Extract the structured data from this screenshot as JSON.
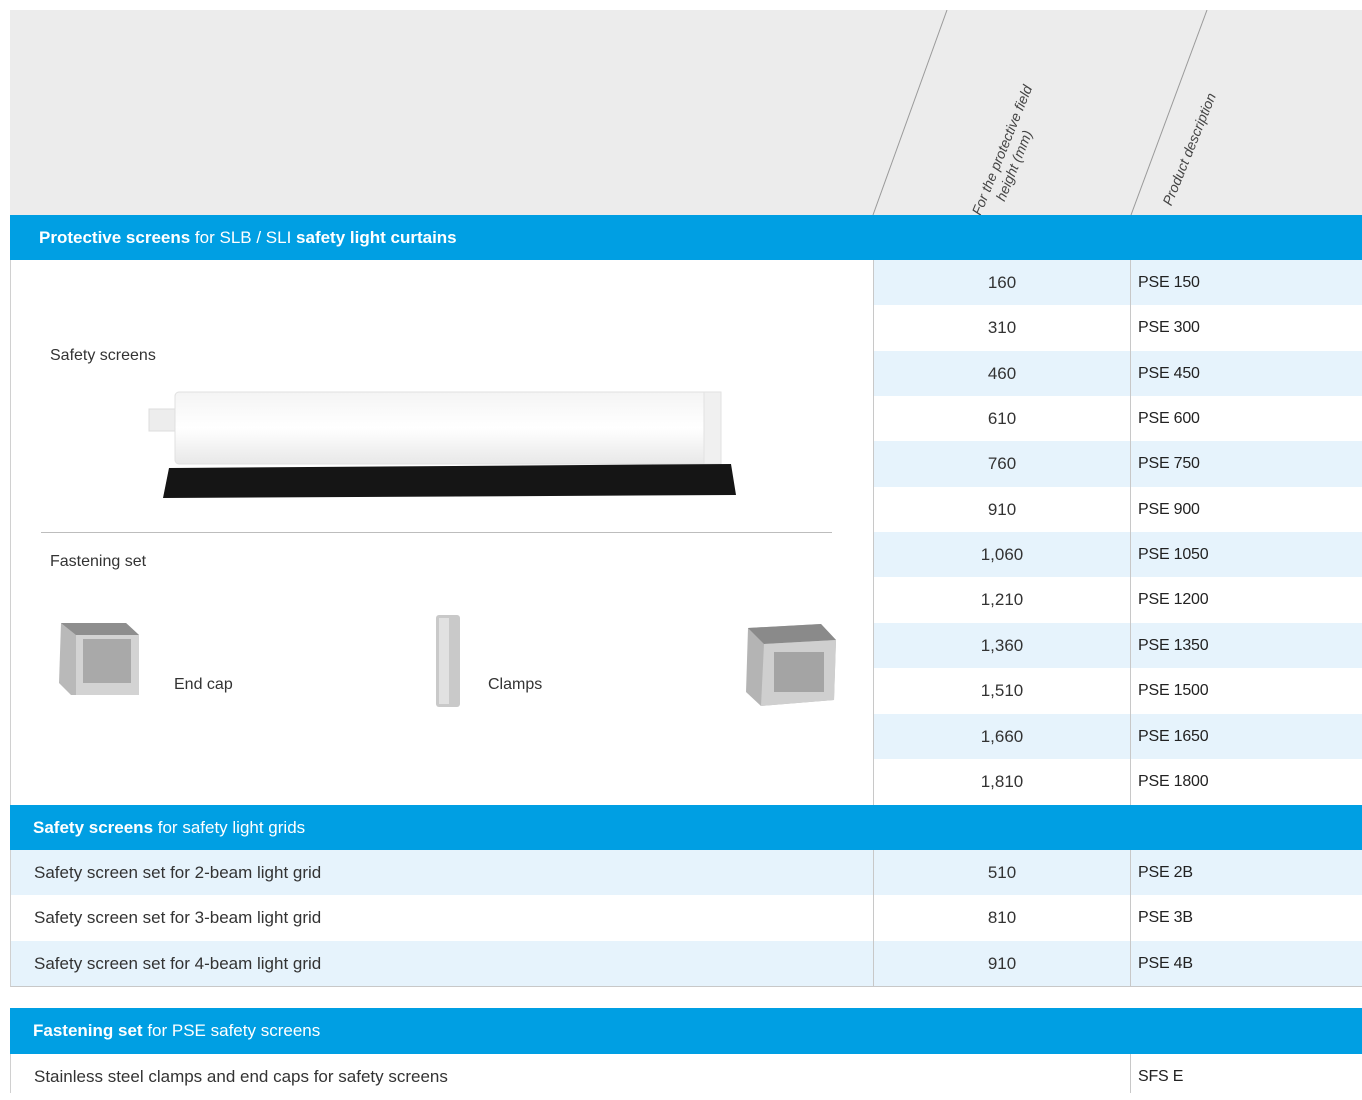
{
  "columns": {
    "height_line1": "For the protective field",
    "height_line2": "height (mm)",
    "product": "Product description"
  },
  "section1": {
    "title_bold1": "Protective screens",
    "title_mid": " for SLB / SLI ",
    "title_bold2": "safety light curtains",
    "safety_screens_label": "Safety screens",
    "fastening_label": "Fastening set",
    "end_cap_label": "End cap",
    "clamps_label": "Clamps",
    "rows": [
      {
        "height": "160",
        "product": "PSE 150"
      },
      {
        "height": "310",
        "product": "PSE 300"
      },
      {
        "height": "460",
        "product": "PSE 450"
      },
      {
        "height": "610",
        "product": "PSE 600"
      },
      {
        "height": "760",
        "product": "PSE 750"
      },
      {
        "height": "910",
        "product": "PSE 900"
      },
      {
        "height": "1,060",
        "product": "PSE 1050"
      },
      {
        "height": "1,210",
        "product": "PSE 1200"
      },
      {
        "height": "1,360",
        "product": "PSE 1350"
      },
      {
        "height": "1,510",
        "product": "PSE 1500"
      },
      {
        "height": "1,660",
        "product": "PSE 1650"
      },
      {
        "height": "1,810",
        "product": "PSE 1800"
      }
    ]
  },
  "section2": {
    "title_bold": "Safety screens",
    "title_rest": " for safety light grids",
    "rows": [
      {
        "desc": "Safety screen set for 2-beam light grid",
        "height": "510",
        "product": "PSE 2B"
      },
      {
        "desc": "Safety screen set for 3-beam light grid",
        "height": "810",
        "product": "PSE 3B"
      },
      {
        "desc": "Safety screen set for 4-beam light grid",
        "height": "910",
        "product": "PSE 4B"
      }
    ]
  },
  "section3": {
    "title_bold": "Fastening set",
    "title_rest": " for PSE safety screens",
    "rows": [
      {
        "desc": "Stainless steel clamps and end caps for safety screens",
        "height": "",
        "product": "SFS E"
      }
    ]
  },
  "colors": {
    "band": "#009fe3",
    "alt_row": "#e6f3fc",
    "header_bg": "#ececec"
  }
}
